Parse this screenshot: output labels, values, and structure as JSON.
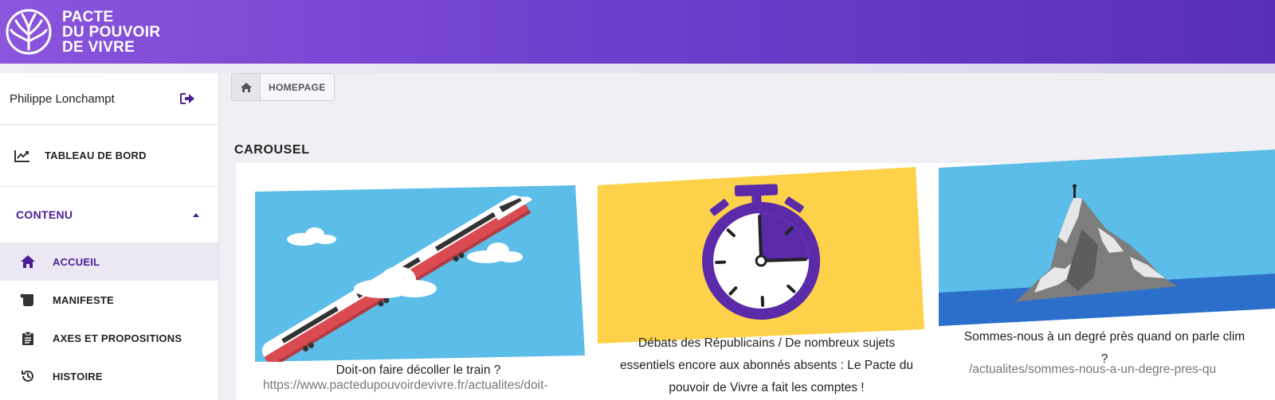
{
  "brand": {
    "name_line1": "PACTE",
    "name_line2": "DU POUVOIR",
    "name_line3": "DE VIVRE",
    "primary_color": "#6f3fcd",
    "accent_color": "#4b1d95"
  },
  "user": {
    "name": "Philippe Lonchampt",
    "logout_icon": "sign-out-icon"
  },
  "sidebar": {
    "dashboard_label": "TABLEAU DE BORD",
    "section_label": "CONTENU",
    "items": [
      {
        "label": "ACCUEIL",
        "icon": "home-icon",
        "active": true
      },
      {
        "label": "MANIFESTE",
        "icon": "scroll-icon",
        "active": false
      },
      {
        "label": "AXES ET PROPOSITIONS",
        "icon": "clipboard-icon",
        "active": false
      },
      {
        "label": "HISTOIRE",
        "icon": "history-icon",
        "active": false
      }
    ]
  },
  "breadcrumb": {
    "current": "HOMEPAGE"
  },
  "section": {
    "title": "CAROUSEL"
  },
  "carousel": [
    {
      "title": "Doit-on faire décoller le train ?",
      "url": "https://www.pactedupouvoirdevivre.fr/actualites/doit-"
    },
    {
      "title_line1": "Débats des Républicains / De nombreux sujets",
      "title_line2": "essentiels encore aux abonnés absents : Le Pacte du",
      "title_line3": "pouvoir de Vivre a fait les comptes !"
    },
    {
      "title_line1": "Sommes-nous à un degré près quand on parle clim",
      "title_line2": "?",
      "url": "/actualites/sommes-nous-a-un-degre-pres-qu"
    }
  ]
}
